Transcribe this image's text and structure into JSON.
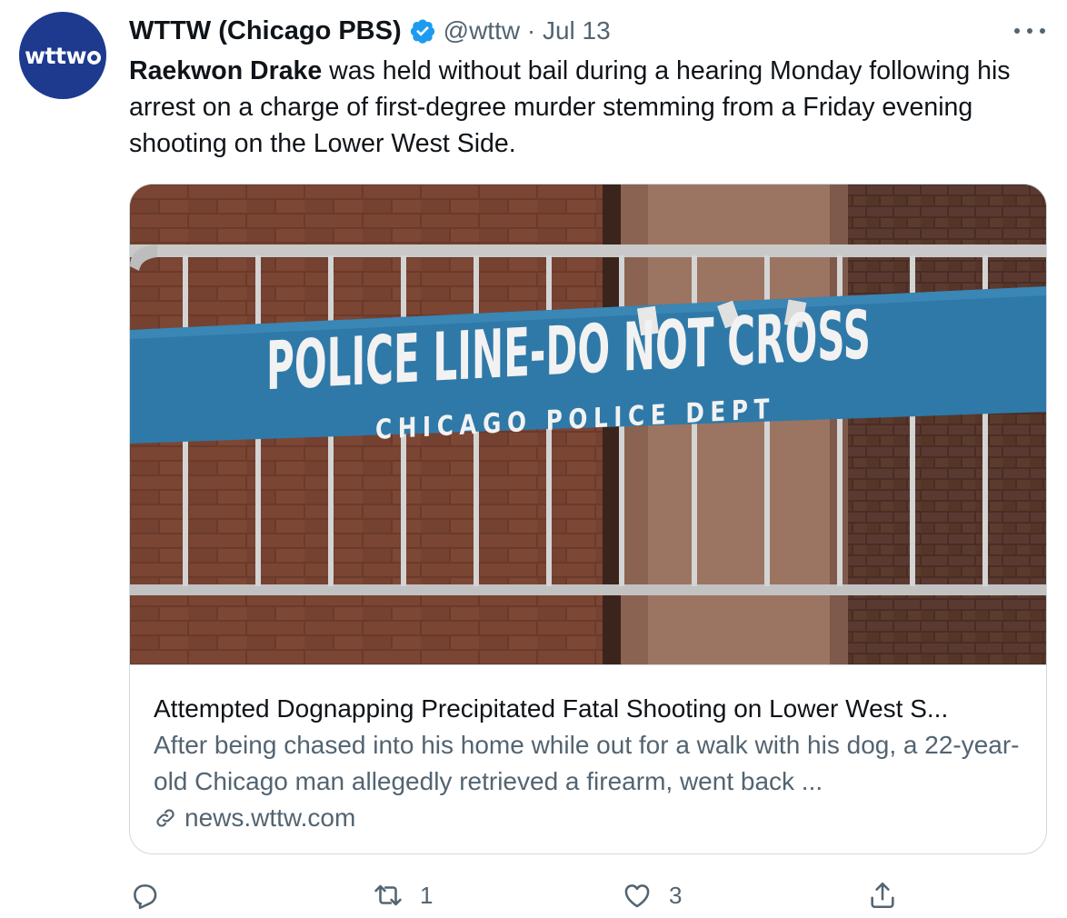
{
  "tweet": {
    "avatar_text": "wttw",
    "display_name": "WTTW (Chicago PBS)",
    "handle_date": "@wttw · Jul 13",
    "text_bold": "Raekwon Drake",
    "text_rest": " was held without bail during a hearing Monday following his arrest on a charge of first-degree murder stemming from a Friday evening shooting on the Lower West Side."
  },
  "card": {
    "sign_line1": "POLICE LINE-DO NOT CROSS",
    "sign_line2": "CHICAGO POLICE DEPT",
    "title": "Attempted Dognapping Precipitated Fatal Shooting on Lower West S...",
    "description": "After being chased into his home while out for a walk with his dog, a 22-year-old Chicago man allegedly retrieved a firearm, went back ...",
    "domain": "news.wttw.com"
  },
  "actions": {
    "reply_count": "",
    "retweet_count": "1",
    "like_count": "3"
  },
  "icons": [
    "verified-badge-icon",
    "more-icon",
    "link-icon",
    "reply-icon",
    "retweet-icon",
    "like-icon",
    "share-icon"
  ],
  "colors": {
    "brand_blue": "#1d9bf0",
    "avatar_bg": "#1d3a8f",
    "secondary_text": "#536471",
    "sign_blue": "#2f79a8"
  }
}
